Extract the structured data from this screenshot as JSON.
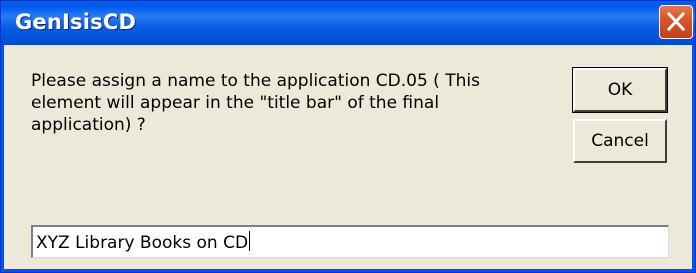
{
  "window": {
    "title": "GenIsisCD",
    "close_icon": "close-icon",
    "colors": {
      "titlebar": "#0058ee",
      "close_button": "#d9552a",
      "face": "#ece9d8"
    }
  },
  "dialog": {
    "message": "Please assign a name to the application CD.05 ( This element will appear in the \"title bar\" of the final application) ?",
    "ok_label": "OK",
    "cancel_label": "Cancel",
    "input_value": "XYZ Library Books on CD"
  }
}
